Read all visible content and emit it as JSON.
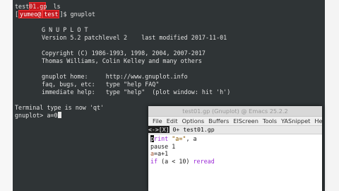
{
  "terminal": {
    "top_command_fragment": "ls",
    "file_listing": "test01.gp",
    "prompt_user": "yumeo@",
    "prompt_dir": "test",
    "prompt_tail": "]$ gnuplot",
    "banner": {
      "logo": "G N U P L O T",
      "version": "Version 5.2 patchlevel 2    last modified 2017-11-01",
      "copyright": "Copyright (C) 1986-1993, 1998, 2004, 2007-2017",
      "authors": "Thomas Williams, Colin Kelley and many others",
      "homepage": "gnuplot home:     http://www.gnuplot.info",
      "faq": "faq, bugs, etc:   type \"help FAQ\"",
      "help": "immediate help:   type \"help\"  (plot window: hit 'h')"
    },
    "terminal_type": "Terminal type is now 'qt'",
    "gnuplot_prompt": "gnuplot> a=0"
  },
  "emacs": {
    "title": "test01.gp (Gnuplot) @ Emacs 25.2.2",
    "menu": [
      "File",
      "Edit",
      "Options",
      "Buffers",
      "ElScreen",
      "Tools",
      "YASnippet",
      "Help"
    ],
    "modeline_tag": "<->[X]",
    "modeline_text": " 0+ test01.gp",
    "buffer_lines": {
      "l1_cursor": "p",
      "l1_kw": "rint",
      "l1_str": " \"a=\"",
      "l1_rest": ", a",
      "l2": "pause 1",
      "l3_var": "a",
      "l3_rest": "=a+1",
      "l4_kw1": "if",
      "l4_mid": " (a < 10) ",
      "l4_kw2": "reread"
    }
  },
  "colors": {
    "terminal_bg": "#2f3436",
    "prompt_red": "#c4161c",
    "keyword_purple": "#9b2bd6"
  }
}
